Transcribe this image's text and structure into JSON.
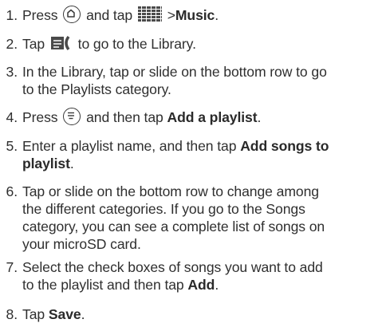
{
  "steps": [
    {
      "num": "1.",
      "text": [
        "Press",
        "and tap",
        ">",
        "Music",
        "."
      ]
    },
    {
      "num": "2.",
      "text": [
        "Tap",
        "to go to the Library."
      ]
    },
    {
      "num": "3.",
      "lines": [
        "In the Library, tap or slide on the bottom row to go",
        "to the Playlists category."
      ]
    },
    {
      "num": "4.",
      "text": [
        "Press",
        "and then tap",
        "Add a playlist",
        "."
      ]
    },
    {
      "num": "5.",
      "text": [
        "Enter a playlist name, and then tap",
        "Add songs to",
        "playlist",
        "."
      ]
    },
    {
      "num": "6.",
      "lines": [
        "Tap or slide on the bottom row to change among",
        "the different categories. If you go to the Songs",
        "category, you can see a complete list of songs on",
        "your microSD card."
      ]
    },
    {
      "num": "7.",
      "text": [
        "Select the check boxes of songs you want to add",
        "to the playlist and then tap",
        "Add",
        "."
      ]
    },
    {
      "num": "8.",
      "text": [
        "Tap",
        "Save",
        "."
      ]
    }
  ],
  "icons": {
    "home": "home-icon",
    "all_apps": "all-apps-grid-icon",
    "library": "library-icon",
    "menu": "menu-icon"
  }
}
